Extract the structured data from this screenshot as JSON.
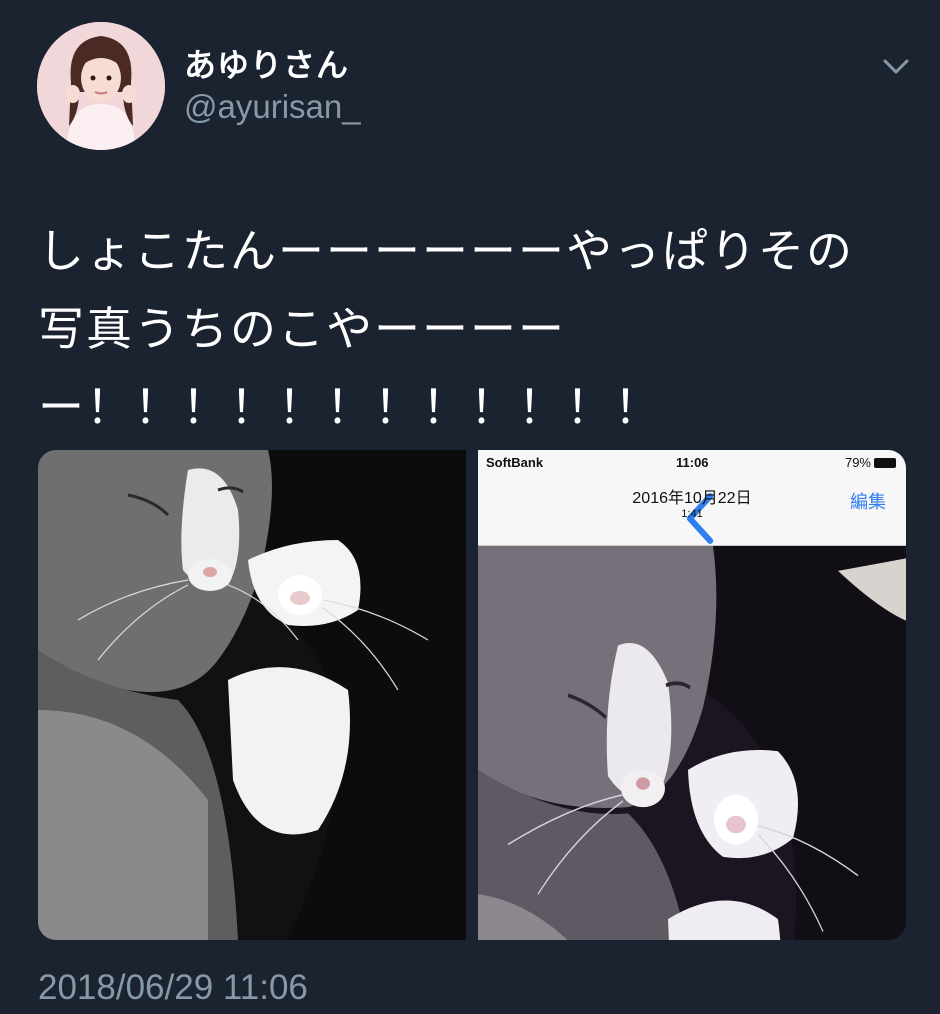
{
  "user": {
    "display_name": "あゆりさん",
    "handle": "@ayurisan_",
    "avatar_icon": "avatar-photo"
  },
  "tweet": {
    "text": "しょこたんーーーーーーやっぱりその\n写真うちのこやーーーー\nー！！！！！！！！！！！！",
    "timestamp": "2018/06/29 11:06"
  },
  "media": {
    "photo_1": "cat-photo",
    "photo_2": "phone-screenshot",
    "screenshot": {
      "carrier": "SoftBank",
      "time": "11:06",
      "battery": "79%",
      "date_title": "2016年10月22日",
      "sub_time": "1:41",
      "edit_label": "編集"
    }
  },
  "colors": {
    "background": "#1b2230",
    "secondary_text": "#8899a6",
    "ios_link": "#2f7ff0"
  }
}
